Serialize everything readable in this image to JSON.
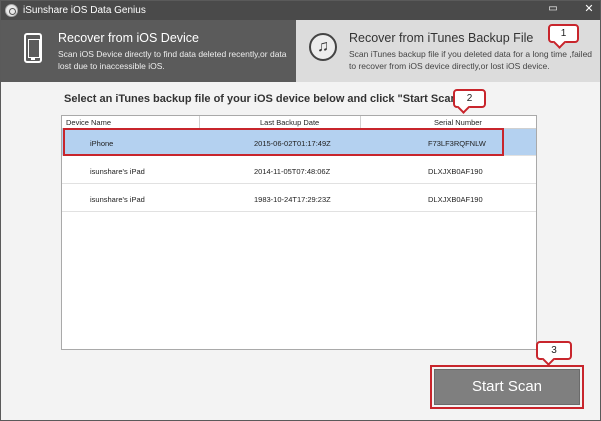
{
  "window": {
    "title": "iSunshare iOS Data Genius",
    "minimize_glyph": "▭",
    "close_glyph": "✕"
  },
  "modes": {
    "device": {
      "title": "Recover from iOS Device",
      "description": "Scan iOS Device directly to find data deleted recently,or data lost due to inaccessible iOS.",
      "icon": "phone-icon"
    },
    "itunes": {
      "title": "Recover from iTunes Backup File",
      "description": "Scan iTunes backup file if you deleted data for a long time ,failed to recover from iOS device directly,or lost iOS device.",
      "icon": "music-note-icon",
      "icon_glyph": "♫"
    }
  },
  "instruction": "Select an iTunes backup file of your iOS device below and click \"Start Scan\".",
  "table": {
    "columns": [
      "Device Name",
      "Last Backup Date",
      "Serial Number"
    ],
    "rows": [
      {
        "device": "iPhone",
        "date": "2015-06-02T01:17:49Z",
        "serial": "F73LF3RQFNLW",
        "selected": true
      },
      {
        "device": "isunshare's iPad",
        "date": "2014-11-05T07:48:06Z",
        "serial": "DLXJXB0AF190",
        "selected": false
      },
      {
        "device": "isunshare's iPad",
        "date": "1983-10-24T17:29:23Z",
        "serial": "DLXJXB0AF190",
        "selected": false
      }
    ]
  },
  "callouts": [
    "1",
    "2",
    "3"
  ],
  "scan_button": {
    "label": "Start Scan"
  },
  "colors": {
    "titlebar": "#4a4a4a",
    "active_mode": "#5b5b5b",
    "inactive_mode": "#dcdcdc",
    "selected_row": "#b4d1f0",
    "annotation_red": "#c8252c",
    "button_gray": "#7f7f7f"
  }
}
